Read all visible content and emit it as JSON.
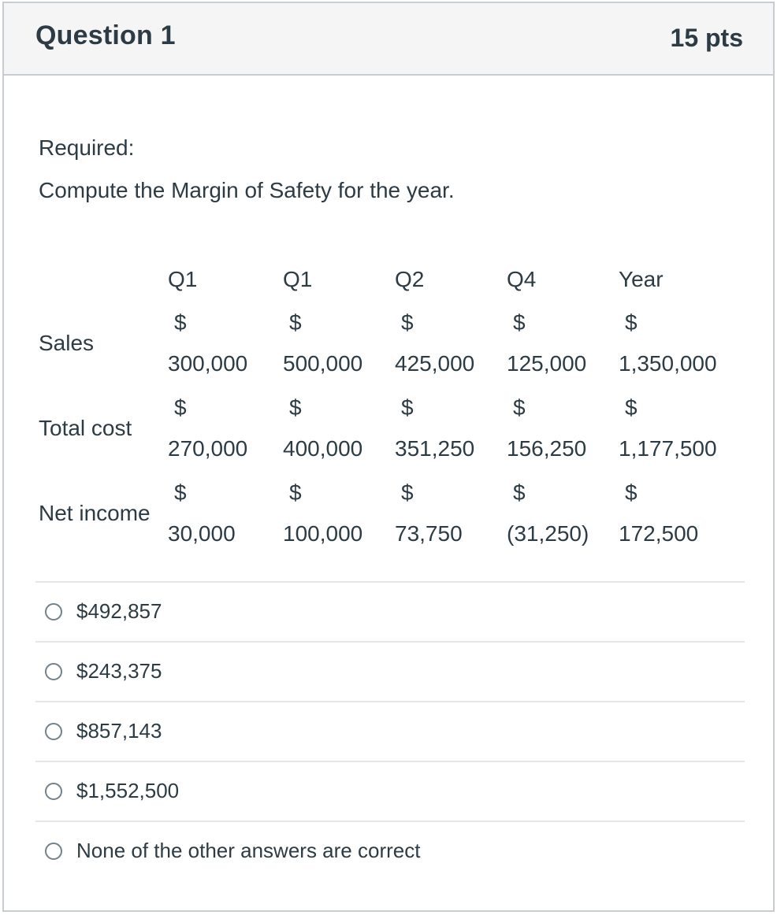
{
  "question": {
    "title": "Question 1",
    "points": "15 pts",
    "required_label": "Required:",
    "prompt": "Compute the Margin of Safety for the year."
  },
  "table": {
    "headers": [
      "",
      "Q1",
      "Q1",
      "Q2",
      "Q4",
      "Year"
    ],
    "rows": [
      {
        "label": "Sales",
        "values": [
          "300,000",
          "500,000",
          "425,000",
          "125,000",
          "1,350,000"
        ]
      },
      {
        "label": "Total cost",
        "values": [
          "270,000",
          "400,000",
          "351,250",
          "156,250",
          "1,177,500"
        ]
      },
      {
        "label": "Net income",
        "values": [
          "30,000",
          "100,000",
          "73,750",
          "(31,250)",
          "172,500"
        ]
      }
    ],
    "currency": "$"
  },
  "answers": [
    {
      "label": "$492,857"
    },
    {
      "label": "$243,375"
    },
    {
      "label": "$857,143"
    },
    {
      "label": "$1,552,500"
    },
    {
      "label": "None of the other answers are correct"
    }
  ]
}
